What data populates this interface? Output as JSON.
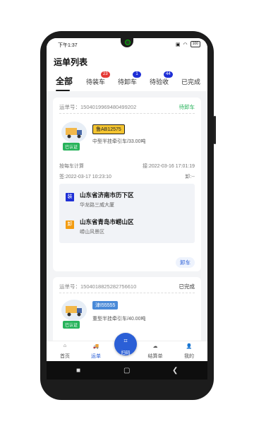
{
  "status_bar": {
    "time": "下午1:37",
    "battery": "100"
  },
  "page_title": "运单列表",
  "tabs": [
    {
      "label": "全部",
      "active": true
    },
    {
      "label": "待装车",
      "badge": "23",
      "badge_color": "#e53935"
    },
    {
      "label": "待卸车",
      "badge": "1",
      "badge_color": "#1e2fd6"
    },
    {
      "label": "待验收",
      "badge": "44",
      "badge_color": "#1e2fd6"
    },
    {
      "label": "已完成"
    }
  ],
  "orders": [
    {
      "waybill": "运单号：1504019969480499202",
      "status": "待卸车",
      "status_color": "#27b35b",
      "plate": "鲁AB12575",
      "plate_style": "yellow",
      "certified": "已认证",
      "truck_info": "中型半挂牵引车/33.00吨",
      "billing": "按每车计算",
      "receive_time": "接:2022-03-16 17:01:19",
      "sign_time": "签:2022-03-17 10:23:10",
      "unload_time": "卸:--",
      "load_marker": "装",
      "load_city": "山东省济南市历下区",
      "load_addr": "华龙路三威大厦",
      "unload_marker": "卸",
      "unload_city": "山东省青岛市崂山区",
      "unload_addr": "崂山风景区",
      "action": "卸车"
    },
    {
      "waybill": "运单号：1504018825282756610",
      "status": "已完成",
      "status_color": "#333333",
      "plate": "津I55555",
      "plate_style": "blue",
      "certified": "已认证",
      "truck_info": "重型半挂牵引车/40.00吨"
    }
  ],
  "bottom_nav": {
    "home": "首页",
    "waybill": "运单",
    "scan": "扫码",
    "settlement": "结算单",
    "mine": "我的"
  },
  "colors": {
    "accent": "#2b5fd6",
    "green": "#27b35b"
  }
}
